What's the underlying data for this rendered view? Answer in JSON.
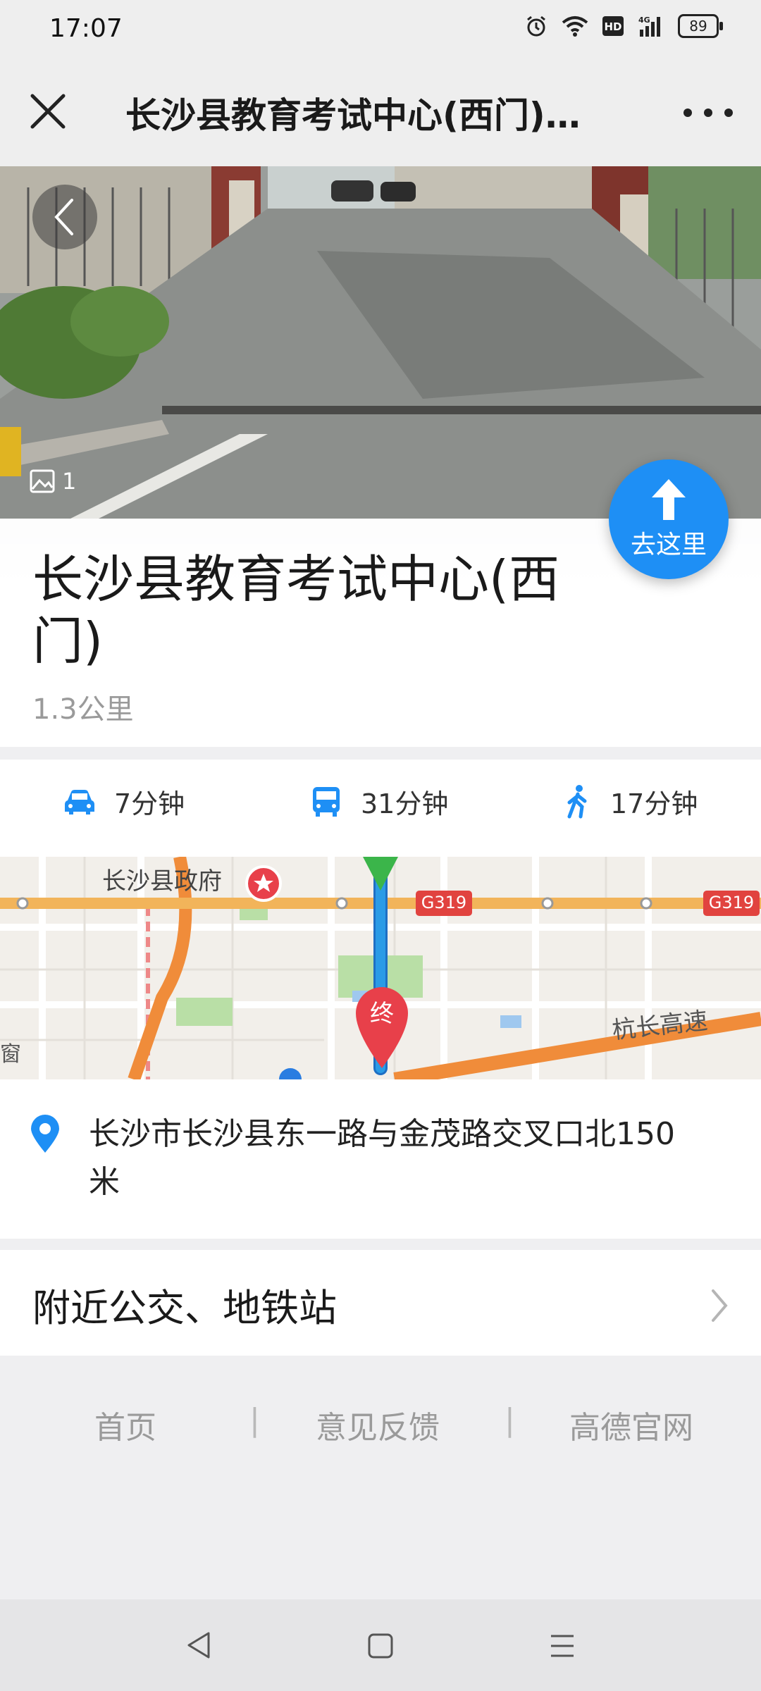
{
  "status": {
    "time": "17:07",
    "battery": "89",
    "network": "4G"
  },
  "header": {
    "title": "长沙县教育考试中心(西门)…",
    "close_icon": "close-icon",
    "more_icon": "more-icon"
  },
  "photo": {
    "count": "1"
  },
  "goto_button": {
    "label": "去这里"
  },
  "place": {
    "name": "长沙县教育考试中心(西门)",
    "distance": "1.3公里"
  },
  "travel": [
    {
      "mode": "car",
      "icon": "car-icon",
      "time": "7分钟"
    },
    {
      "mode": "bus",
      "icon": "bus-icon",
      "time": "31分钟"
    },
    {
      "mode": "walk",
      "icon": "walk-icon",
      "time": "17分钟"
    }
  ],
  "map": {
    "poi_label": "长沙县政府",
    "road_badge_1": "G319",
    "road_badge_2": "G319",
    "highway_label": "杭长高速",
    "end_marker": "终",
    "edge_label": "窗"
  },
  "address": {
    "text": "长沙市长沙县东一路与金茂路交叉口北150米"
  },
  "nearby": {
    "label": "附近公交、地铁站"
  },
  "footer": {
    "home": "首页",
    "feedback": "意见反馈",
    "official": "高德官网",
    "separator": "|"
  },
  "colors": {
    "accent": "#1e8ff5",
    "route": "#2a9be6",
    "road_orange": "#f08c3a",
    "end_marker": "#e8404a"
  }
}
